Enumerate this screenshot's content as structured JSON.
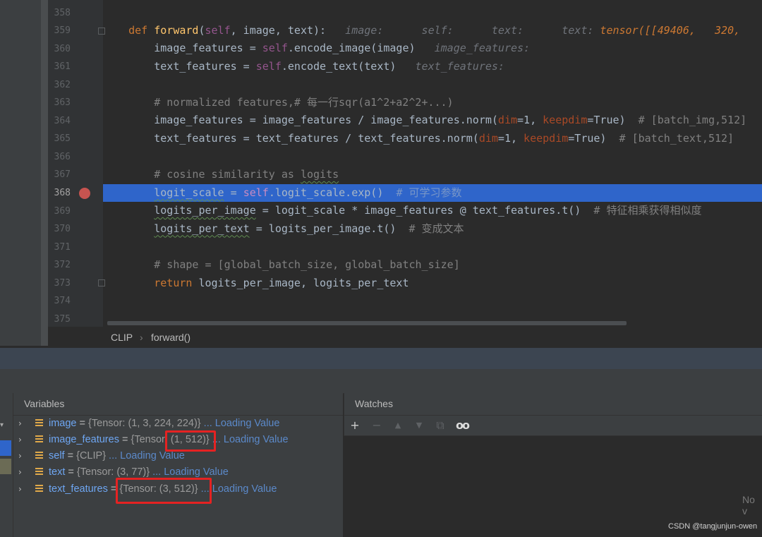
{
  "editor": {
    "line_numbers": [
      "358",
      "359",
      "360",
      "361",
      "362",
      "363",
      "364",
      "365",
      "366",
      "367",
      "368",
      "369",
      "370",
      "371",
      "372",
      "373",
      "374",
      "375"
    ],
    "current_line": "368",
    "lines": {
      "l359": {
        "kw": "def ",
        "fn": "forward",
        "open": "(",
        "self": "self",
        ", image, text):": ", image, text):",
        "hints": "   image:      self:      text:      text: ",
        "hint_val": "tensor([[49406,   320,"
      },
      "l360": {
        "a": "        image_features = ",
        "self": "self",
        ".encode_image(image)": ".encode_image(image)",
        "hint": "   image_features:"
      },
      "l361": {
        "a": "        text_features = ",
        "self": "self",
        "b": ".encode_text(text)",
        "hint": "   text_features:"
      },
      "l363": {
        "comment": "        # normalized features,# 每一行sqr(a1^2+a2^2+...)"
      },
      "l364": {
        "a": "        image_features = image_features / image_features.norm(",
        "p1": "dim",
        "eq1": "=1, ",
        "p2": "keepdim",
        "eq2": "=True)  ",
        "comment": "# [batch_img,512]"
      },
      "l365": {
        "a": "        text_features = text_features / text_features.norm(",
        "p1": "dim",
        "eq1": "=1, ",
        "p2": "keepdim",
        "eq2": "=True)  ",
        "comment": "# [batch_text,512]"
      },
      "l367": {
        "pre": "        # cosine similarity as ",
        "w": "logits"
      },
      "l368": {
        "pre": "        ",
        "w": "logit_scale",
        " = ": " = ",
        "self": "self",
        "b": ".logit_scale.exp()  ",
        "comment": "# 可学习参数"
      },
      "l369": {
        "pre": "        ",
        "w": "logits_per_image",
        "b": " = logit_scale * image_features @ text_features.t()  ",
        "comment": "# 特征相乘获得相似度"
      },
      "l370": {
        "pre": "        ",
        "w": "logits_per_text",
        "b": " = logits_per_image.t()  ",
        "comment": "# 变成文本"
      },
      "l372": {
        "comment": "        # shape = [global_batch_size, global_batch_size]"
      },
      "l373": {
        "pre": "        ",
        "kw": "return ",
        "b": "logits_per_image, logits_per_text"
      }
    }
  },
  "breadcrumbs": {
    "item1": "CLIP",
    "sep": "›",
    "item2": "forward()"
  },
  "variables": {
    "title": "Variables",
    "rows": [
      {
        "name": "image",
        "eq": " = ",
        "value": "{Tensor: (1, 3, 224, 224)}",
        "loading": " ... Loading Value"
      },
      {
        "name": "image_features",
        "eq": " = ",
        "value": "{Tensor: (1, 512)}",
        "loading": " ... Loading Value"
      },
      {
        "name": "self",
        "eq": " = ",
        "value": "{CLIP}",
        "loading": " ... Loading Value"
      },
      {
        "name": "text",
        "eq": " = ",
        "value": "{Tensor: (3, 77)}",
        "loading": " ... Loading Value"
      },
      {
        "name": "text_features",
        "eq": " = ",
        "value": "{Tensor: (3, 512)}",
        "loading": " ... Loading Value"
      }
    ]
  },
  "watches": {
    "title": "Watches",
    "empty_text": "No v",
    "toolbar": {
      "add": "+",
      "remove": "−",
      "up": "▲",
      "down": "▼",
      "copy": "⧉",
      "glasses": "oo"
    }
  },
  "watermark": "CSDN @tangjunjun-owen",
  "colors": {
    "breakpoint": "#c75450",
    "highlight": "#2f65ca",
    "keyword": "#cc7832",
    "self": "#94558d",
    "annotation_box": "#e52222"
  }
}
